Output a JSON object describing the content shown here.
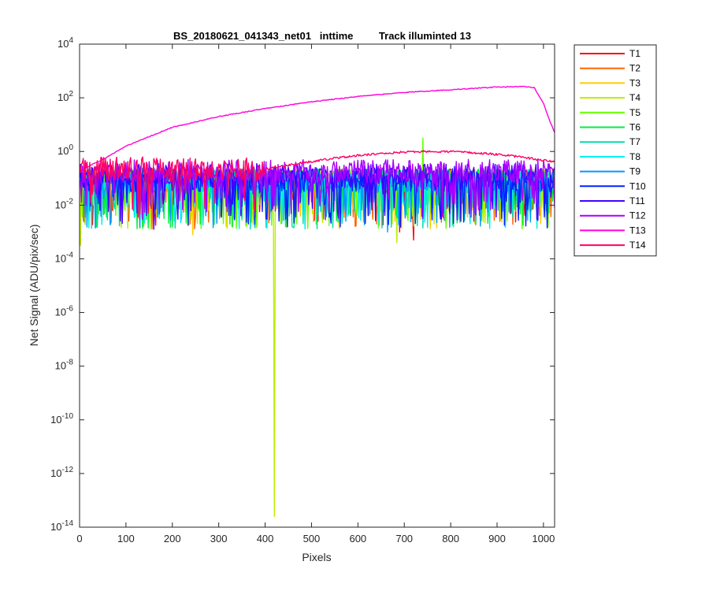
{
  "chart_data": {
    "type": "line",
    "title": "BS_20180621_041343_net01   inttime         Track illuminted 13",
    "xlabel": "Pixels",
    "ylabel": "Net Signal (ADU/pix/sec)",
    "xlim": [
      0,
      1024
    ],
    "ylim_log10": [
      -14,
      4
    ],
    "yscale": "log",
    "x_ticks": [
      0,
      100,
      200,
      300,
      400,
      500,
      600,
      700,
      800,
      900,
      1000
    ],
    "y_tick_exponents": [
      -14,
      -12,
      -10,
      -8,
      -6,
      -4,
      -2,
      0,
      2,
      4
    ],
    "legend_position": "outside-top-right",
    "grid": false,
    "series": [
      {
        "name": "T1",
        "color": "#ff0000",
        "kind": "noise",
        "center_log": -1.1,
        "spikes": [
          [
            690,
            -3.0
          ],
          [
            720,
            -3.3
          ]
        ]
      },
      {
        "name": "T2",
        "color": "#ff6600",
        "kind": "noise",
        "center_log": -1.1,
        "spikes": [
          [
            640,
            -2.7
          ]
        ]
      },
      {
        "name": "T3",
        "color": "#ffcc00",
        "kind": "noise",
        "center_log": -1.1,
        "spikes": [
          [
            245,
            -3.1
          ],
          [
            680,
            -2.6
          ]
        ]
      },
      {
        "name": "T4",
        "color": "#bbee00",
        "kind": "noise",
        "center_log": -1.1,
        "spikes": [
          [
            2,
            -3.5
          ],
          [
            420,
            -13.6
          ],
          [
            685,
            -3.4
          ]
        ]
      },
      {
        "name": "T5",
        "color": "#66ff00",
        "kind": "noise",
        "center_log": -1.1,
        "spikes": [
          [
            740,
            0.5
          ]
        ]
      },
      {
        "name": "T6",
        "color": "#00ee44",
        "kind": "noise",
        "center_log": -1.1,
        "spikes": [
          [
            200,
            -2.8
          ]
        ]
      },
      {
        "name": "T7",
        "color": "#00ddaa",
        "kind": "noise",
        "center_log": -1.1,
        "spikes": [
          [
            350,
            -2.5
          ]
        ]
      },
      {
        "name": "T8",
        "color": "#00eeee",
        "kind": "noise",
        "center_log": -1.1,
        "spikes": [
          [
            120,
            -2.4
          ]
        ]
      },
      {
        "name": "T9",
        "color": "#0099ff",
        "kind": "noise",
        "center_log": -1.1,
        "spikes": [
          [
            665,
            -3.0
          ]
        ]
      },
      {
        "name": "T10",
        "color": "#0022ff",
        "kind": "noise",
        "center_log": -1.05,
        "spikes": [
          [
            540,
            -2.3
          ]
        ]
      },
      {
        "name": "T11",
        "color": "#4400ff",
        "kind": "noise",
        "center_log": -0.9,
        "spikes": [
          [
            160,
            -2.9
          ]
        ]
      },
      {
        "name": "T12",
        "color": "#aa00ff",
        "kind": "noise",
        "center_log": -0.75,
        "spikes": [
          [
            850,
            -2.6
          ]
        ]
      },
      {
        "name": "T13",
        "color": "#ff00dd",
        "kind": "smooth",
        "x": [
          0,
          25,
          50,
          100,
          200,
          300,
          400,
          500,
          600,
          700,
          800,
          900,
          960,
          980,
          1000,
          1010,
          1024
        ],
        "y_log10": [
          -0.8,
          -0.5,
          -0.3,
          0.2,
          0.9,
          1.3,
          1.6,
          1.85,
          2.05,
          2.2,
          2.3,
          2.4,
          2.42,
          2.38,
          1.8,
          1.3,
          0.7
        ]
      },
      {
        "name": "T14",
        "color": "#ff0066",
        "kind": "noise",
        "center_log": -0.65,
        "spikes": [],
        "hump": {
          "start": 400,
          "peak": 760,
          "end": 1024,
          "peak_log": 0.0,
          "end_log": -0.4
        }
      }
    ]
  }
}
